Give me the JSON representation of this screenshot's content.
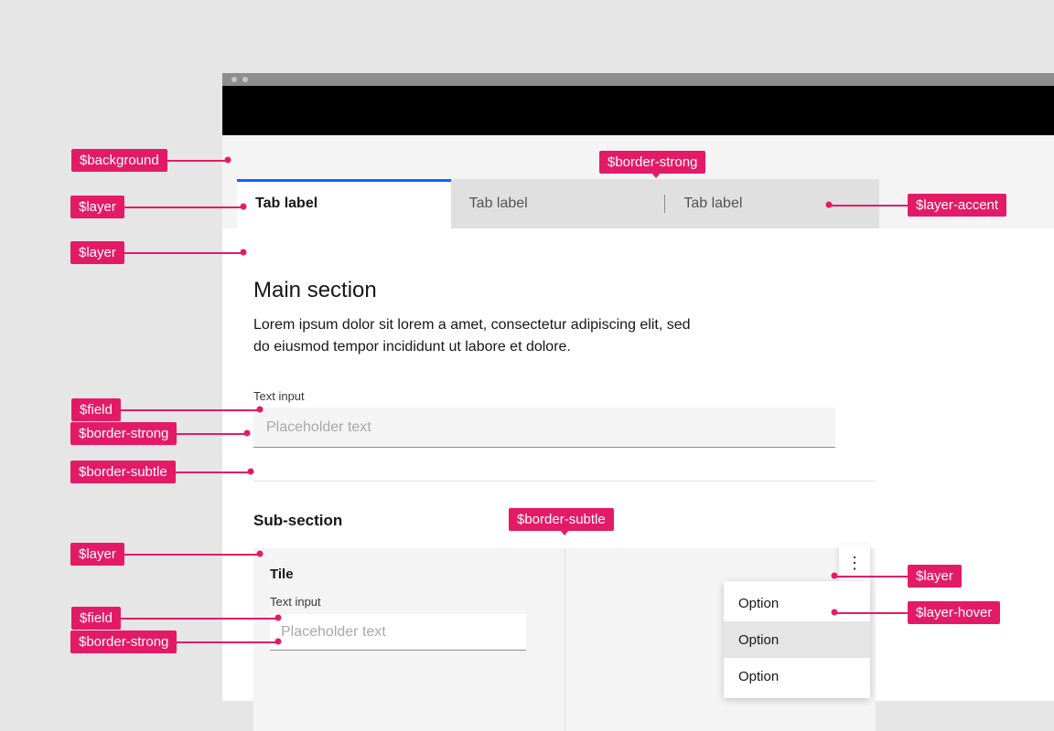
{
  "tokens": {
    "background": "$background",
    "layer": "$layer",
    "layer_accent": "$layer-accent",
    "layer_hover": "$layer-hover",
    "field": "$field",
    "border_strong": "$border-strong",
    "border_subtle": "$border-subtle"
  },
  "tabs": {
    "items": [
      {
        "label": "Tab label",
        "active": true
      },
      {
        "label": "Tab label",
        "active": false
      },
      {
        "label": "Tab label",
        "active": false
      }
    ]
  },
  "main": {
    "heading": "Main section",
    "paragraph": "Lorem ipsum dolor sit lorem a amet, consectetur adipiscing elit, sed do eiusmod tempor incididunt ut labore et dolore."
  },
  "input1": {
    "label": "Text input",
    "placeholder": "Placeholder text"
  },
  "sub": {
    "heading": "Sub-section"
  },
  "tile": {
    "title": "Tile",
    "input_label": "Text input",
    "input_placeholder": "Placeholder text"
  },
  "menu": {
    "items": [
      "Option",
      "Option",
      "Option"
    ],
    "hover_index": 1
  }
}
